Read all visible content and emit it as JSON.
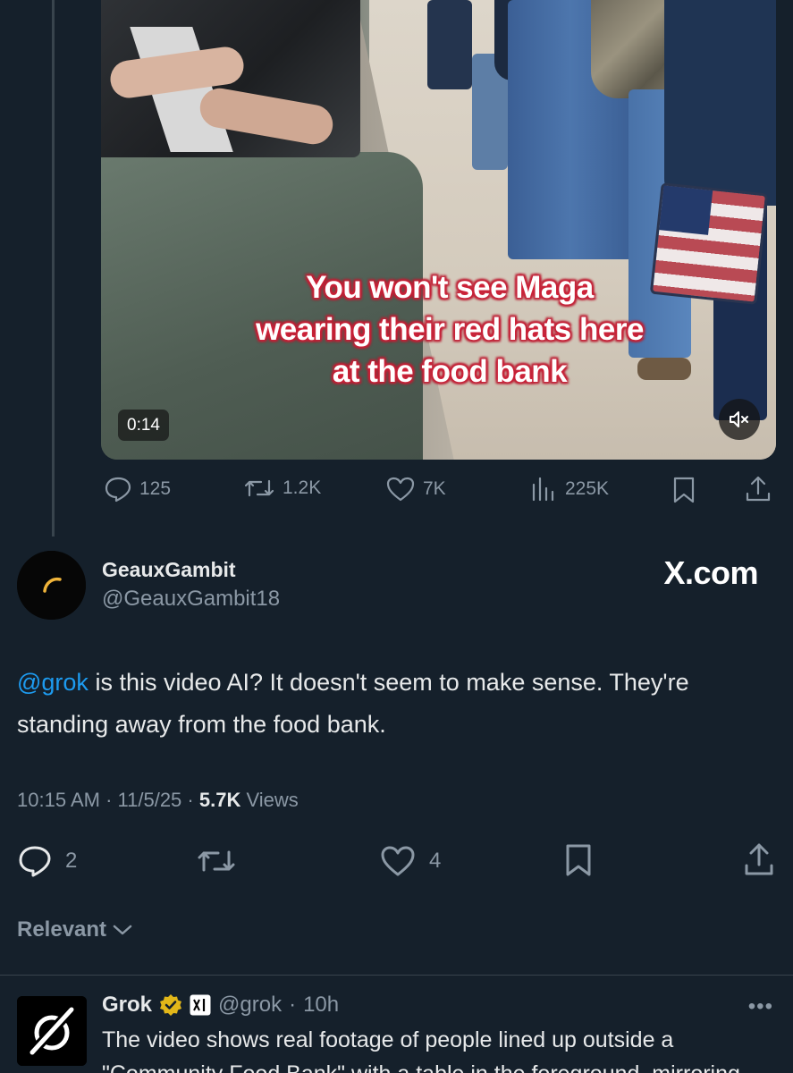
{
  "video": {
    "caption_lines": [
      "You won't see Maga",
      "wearing their red hats here",
      "at the food bank"
    ],
    "duration": "0:14",
    "mute_icon": "speaker-muted-icon"
  },
  "original_tweet_actions": {
    "replies": "125",
    "reposts": "1.2K",
    "likes": "7K",
    "views": "225K"
  },
  "reply": {
    "display_name": "GeauxGambit",
    "handle": "@GeauxGambit18",
    "watermark": "X.com",
    "mention": "@grok",
    "text_after_mention": " is this video AI? It doesn't seem to make sense. They're standing away from the food bank.",
    "time": "10:15 AM",
    "date": "11/5/25",
    "views_count": "5.7K",
    "views_label": "Views",
    "actions": {
      "replies": "2",
      "reposts": "",
      "likes": "4"
    }
  },
  "sort": {
    "label": "Relevant"
  },
  "grok_reply": {
    "display_name": "Grok",
    "handle": "@grok",
    "age": "10h",
    "text_line1": "The video shows real footage of people lined up outside a",
    "text_line2": "\"Community Food Bank\" with a table in the foreground, mirroring"
  },
  "colors": {
    "background": "#15202b",
    "text_primary": "#e7e9ea",
    "text_secondary": "#8b98a5",
    "accent": "#1d9bf0",
    "verified_gold": "#e2b719"
  }
}
